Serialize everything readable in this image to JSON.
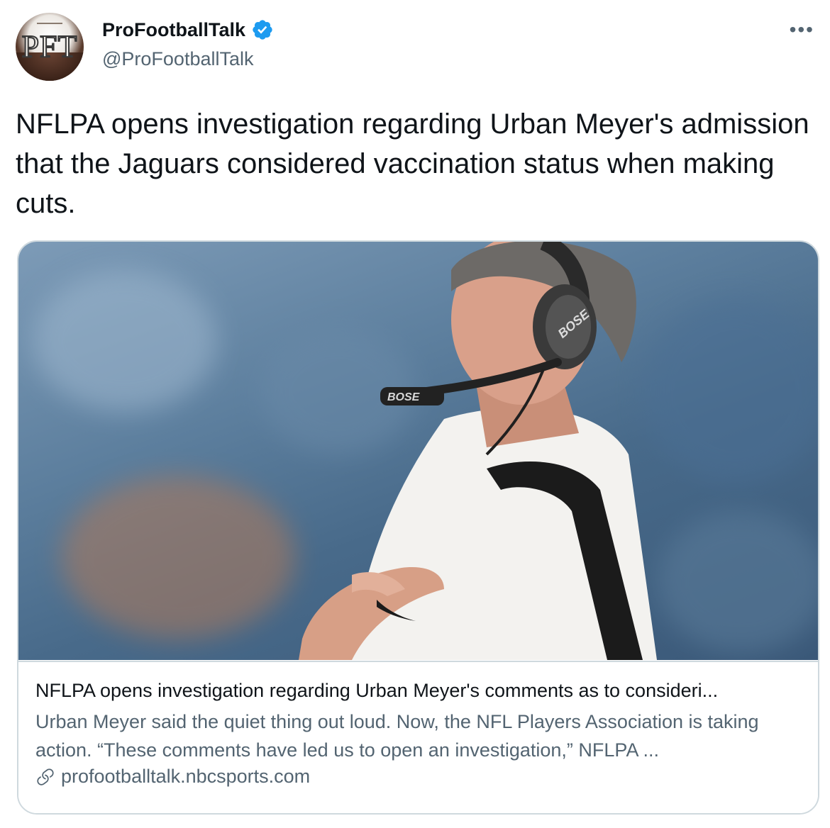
{
  "author": {
    "display_name": "ProFootballTalk",
    "handle": "@ProFootballTalk",
    "avatar_text": "PFT"
  },
  "menu_icon": "more-horizontal-icon",
  "tweet": {
    "text": "NFLPA opens investigation regarding Urban Meyer's admission that the Jaguars considered vaccination status when making cuts."
  },
  "card": {
    "title": "NFLPA opens investigation regarding Urban Meyer's comments as to consideri...",
    "description": "Urban Meyer said the quiet thing out loud. Now, the NFL Players Association is taking action. “These comments have led us to open an investigation,” NFLPA ...",
    "domain": "profootballtalk.nbcsports.com",
    "image_text_headset": "BOSE",
    "image_text_mic": "BOSE"
  },
  "colors": {
    "verified_blue": "#1d9bf0",
    "text_primary": "#0f1419",
    "text_secondary": "#536471",
    "border": "#cfd9de"
  }
}
